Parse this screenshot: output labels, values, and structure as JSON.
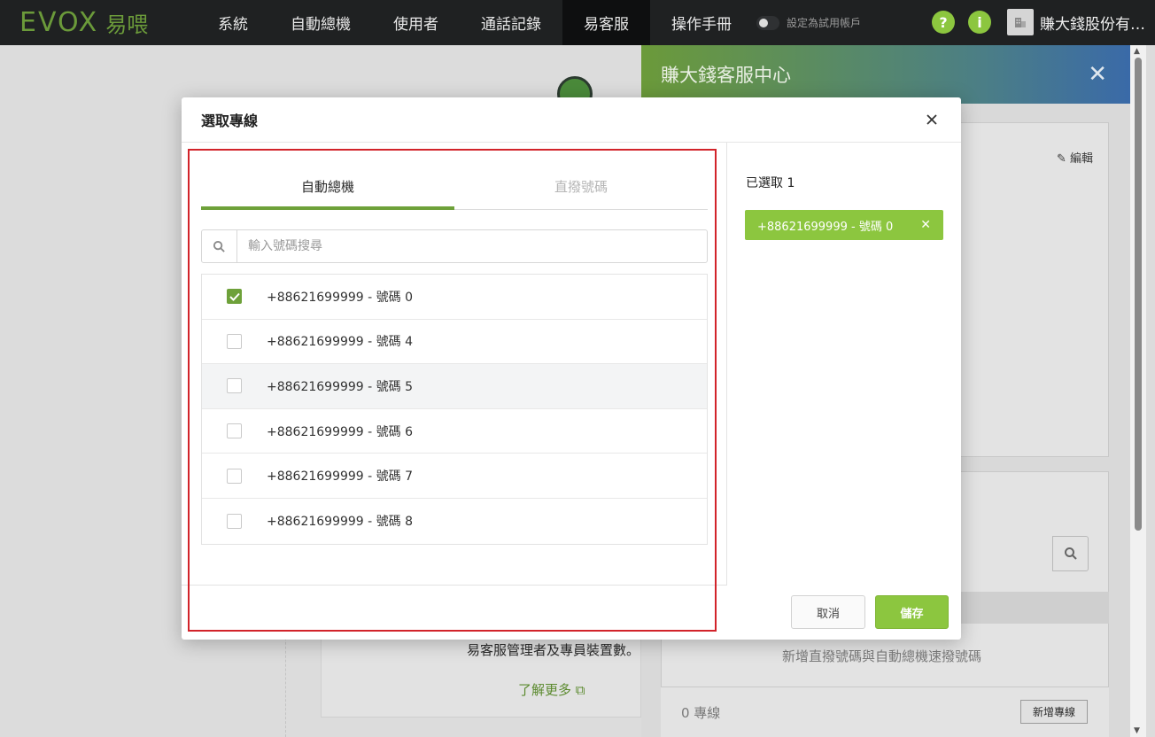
{
  "topbar": {
    "logo_text": "EVOX",
    "logo_cn": "易喂",
    "nav": [
      {
        "label": "系統"
      },
      {
        "label": "自動總機"
      },
      {
        "label": "使用者"
      },
      {
        "label": "通話記錄"
      },
      {
        "label": "易客服",
        "active": true
      },
      {
        "label": "操作手冊"
      }
    ],
    "trial_label": "設定為試用帳戶",
    "help_glyph": "?",
    "info_glyph": "i",
    "org_name": "賺大錢股份有限公司"
  },
  "background": {
    "description": "易客服管理者及專員裝置數。",
    "learn_more": "了解更多"
  },
  "side_panel": {
    "title": "賺大錢客服中心",
    "edit_label": "編輯",
    "add_desc": "新增直撥號碼與自動總機速撥號碼",
    "line_count": "0 專線",
    "add_line_button": "新增專線"
  },
  "modal": {
    "title": "選取專線",
    "tabs": [
      {
        "label": "自動總機",
        "active": true
      },
      {
        "label": "直撥號碼",
        "active": false
      }
    ],
    "search": {
      "placeholder": "輸入號碼搜尋",
      "value": ""
    },
    "items": [
      {
        "label": "+88621699999 - 號碼 0",
        "checked": true
      },
      {
        "label": "+88621699999 - 號碼 4",
        "checked": false
      },
      {
        "label": "+88621699999 - 號碼 5",
        "checked": false
      },
      {
        "label": "+88621699999 - 號碼 6",
        "checked": false
      },
      {
        "label": "+88621699999 - 號碼 7",
        "checked": false
      },
      {
        "label": "+88621699999 - 號碼 8",
        "checked": false
      }
    ],
    "selected_count": "已選取 1",
    "selected_chips": [
      {
        "label": "+88621699999 - 號碼 0"
      }
    ],
    "cancel_label": "取消",
    "save_label": "儲存"
  },
  "colors": {
    "accent": "#8cc63f",
    "accent_dark": "#6ea13a",
    "topbar": "#1f2122",
    "highlight_border": "#d2232a"
  }
}
